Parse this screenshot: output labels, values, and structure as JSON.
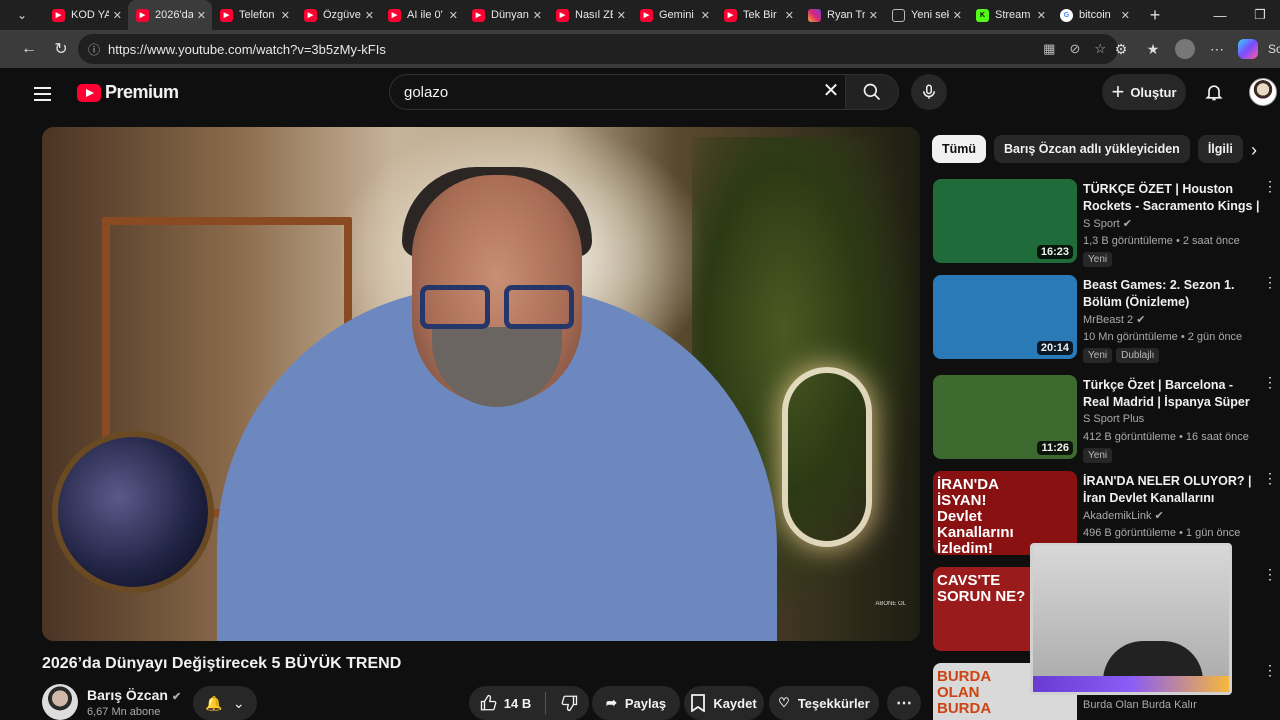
{
  "browser": {
    "tabs": [
      {
        "label": "KOD YA",
        "favicon": "youtube-icon",
        "active": false
      },
      {
        "label": "2026'da",
        "favicon": "youtube-icon",
        "active": true
      },
      {
        "label": "Telefon",
        "favicon": "youtube-icon",
        "active": false
      },
      {
        "label": "Özgüve",
        "favicon": "youtube-icon",
        "active": false
      },
      {
        "label": "AI ile 0'",
        "favicon": "youtube-icon",
        "active": false
      },
      {
        "label": "Dünyan",
        "favicon": "youtube-icon",
        "active": false
      },
      {
        "label": "Nasıl ZE",
        "favicon": "youtube-icon",
        "active": false
      },
      {
        "label": "Gemini",
        "favicon": "youtube-icon",
        "active": false
      },
      {
        "label": "Tek Bir",
        "favicon": "youtube-icon",
        "active": false
      },
      {
        "label": "Ryan Tr",
        "favicon": "instagram-icon",
        "active": false
      },
      {
        "label": "Yeni sek",
        "favicon": "new-tab-icon",
        "active": false
      },
      {
        "label": "Stream",
        "favicon": "kick-icon",
        "active": false
      },
      {
        "label": "bitcoin",
        "favicon": "google-icon",
        "active": false
      }
    ],
    "url": "https://www.youtube.com/watch?v=3b5zMy-kFIs",
    "sidebar_label": "Soh"
  },
  "header": {
    "brand": "Premium",
    "search_query": "golazo",
    "create_label": "Oluştur"
  },
  "video": {
    "title": "2026’da Dünyayı Değiştirecek 5 BÜYÜK TREND",
    "watermark": "ABONE OL",
    "channel_name": "Barış Özcan",
    "subscribers": "6,67 Mn abone",
    "likes": "14 B",
    "share_label": "Paylaş",
    "save_label": "Kaydet",
    "thanks_label": "Teşekkürler"
  },
  "chips": [
    "Tümü",
    "Barış Özcan adlı yükleyiciden",
    "İlgili"
  ],
  "recommendations": [
    {
      "title": "TÜRKÇE ÖZET | Houston Rockets - Sacramento Kings | ...",
      "channel": "S Sport",
      "verified": true,
      "meta": "1,3 B görüntüleme • 2 saat önce",
      "duration": "16:23",
      "badges": [
        "Yeni"
      ],
      "thumb_color": "#1f6b3a"
    },
    {
      "title": "Beast Games: 2. Sezon 1. Bölüm (Önizleme)",
      "channel": "MrBeast 2",
      "verified": true,
      "meta": "10 Mn görüntüleme • 2 gün önce",
      "duration": "20:14",
      "badges": [
        "Yeni",
        "Dublajlı"
      ],
      "thumb_color": "#2a7ab8"
    },
    {
      "title": "Türkçe Özet | Barcelona - Real Madrid | İspanya Süper Kupası...",
      "channel": "S Sport Plus",
      "verified": false,
      "meta": "412 B görüntüleme • 16 saat önce",
      "duration": "11:26",
      "badges": [
        "Yeni"
      ],
      "thumb_color": "#3c6a2f"
    },
    {
      "title": "İRAN'DA NELER OLUYOR? | İran Devlet Kanallarını İzledim!",
      "channel": "AkademikLink",
      "verified": true,
      "meta": "496 B görüntüleme • 1 gün önce",
      "duration": "",
      "badges": [],
      "thumb_color": "#8a1111",
      "thumb_text": "İRAN'DA İSYAN! Devlet Kanallarını İzledim!"
    },
    {
      "title": "",
      "channel": "",
      "verified": false,
      "meta": "",
      "duration": "",
      "badges": [],
      "thumb_color": "#9a1b1b",
      "thumb_text": "CAVS'TE SORUN NE?"
    },
    {
      "title": "",
      "channel": "Burda Olan Burda Kalır",
      "verified": false,
      "meta": "",
      "duration": "",
      "badges": [],
      "thumb_color": "#d9d9d9",
      "thumb_text": "BURDA OLAN BURDA"
    }
  ],
  "colors": {
    "brand_red": "#ff0033",
    "background": "#0f0f0f",
    "chip_bg": "#272727"
  }
}
